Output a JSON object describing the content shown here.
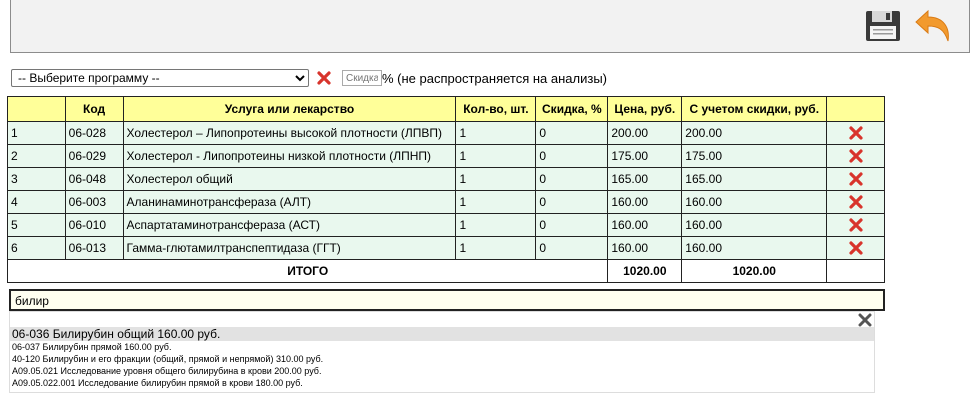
{
  "toolbar": {
    "save_icon": "floppy-disk-icon",
    "back_icon": "undo-arrow-icon",
    "accent_back": "#f29a2e"
  },
  "program": {
    "selected": "-- Выберите программу --",
    "clear_icon": "red-x-icon",
    "discount_placeholder": "Скидка",
    "discount_note": "% (не распространяется на анализы)"
  },
  "table": {
    "headers": [
      "",
      "Код",
      "Услуга или лекарство",
      "Кол-во, шт.",
      "Скидка, %",
      "Цена, руб.",
      "С учетом скидки, руб.",
      ""
    ],
    "rows": [
      {
        "n": "1",
        "code": "06-028",
        "name": "Холестерол – Липопротеины высокой плотности (ЛПВП)",
        "qty": "1",
        "disc": "0",
        "price": "200.00",
        "total": "200.00"
      },
      {
        "n": "2",
        "code": "06-029",
        "name": "Холестерол - Липопротеины низкой плотности (ЛПНП)",
        "qty": "1",
        "disc": "0",
        "price": "175.00",
        "total": "175.00"
      },
      {
        "n": "3",
        "code": "06-048",
        "name": "Холестерол общий",
        "qty": "1",
        "disc": "0",
        "price": "165.00",
        "total": "165.00"
      },
      {
        "n": "4",
        "code": "06-003",
        "name": "Аланинаминотрансфераза (АЛТ)",
        "qty": "1",
        "disc": "0",
        "price": "160.00",
        "total": "160.00"
      },
      {
        "n": "5",
        "code": "06-010",
        "name": "Аспартатаминотрансфераза (АСТ)",
        "qty": "1",
        "disc": "0",
        "price": "160.00",
        "total": "160.00"
      },
      {
        "n": "6",
        "code": "06-013",
        "name": "Гамма-глютамилтранспептидаза (ГГТ)",
        "qty": "1",
        "disc": "0",
        "price": "160.00",
        "total": "160.00"
      }
    ],
    "total_label": "ИТОГО",
    "total_price": "1020.00",
    "total_discounted": "1020.00"
  },
  "search": {
    "value": "билир"
  },
  "suggestions": [
    "06-036 Билирубин общий 160.00 руб.",
    "06-037 Билирубин прямой 160.00 руб.",
    "40-120 Билирубин и его фракции (общий, прямой и непрямой) 310.00 руб.",
    "A09.05.021 Исследование уровня общего билирубина в крови 200.00 руб.",
    "A09.05.022.001 Исследование билирубин прямой в крови 180.00 руб."
  ]
}
